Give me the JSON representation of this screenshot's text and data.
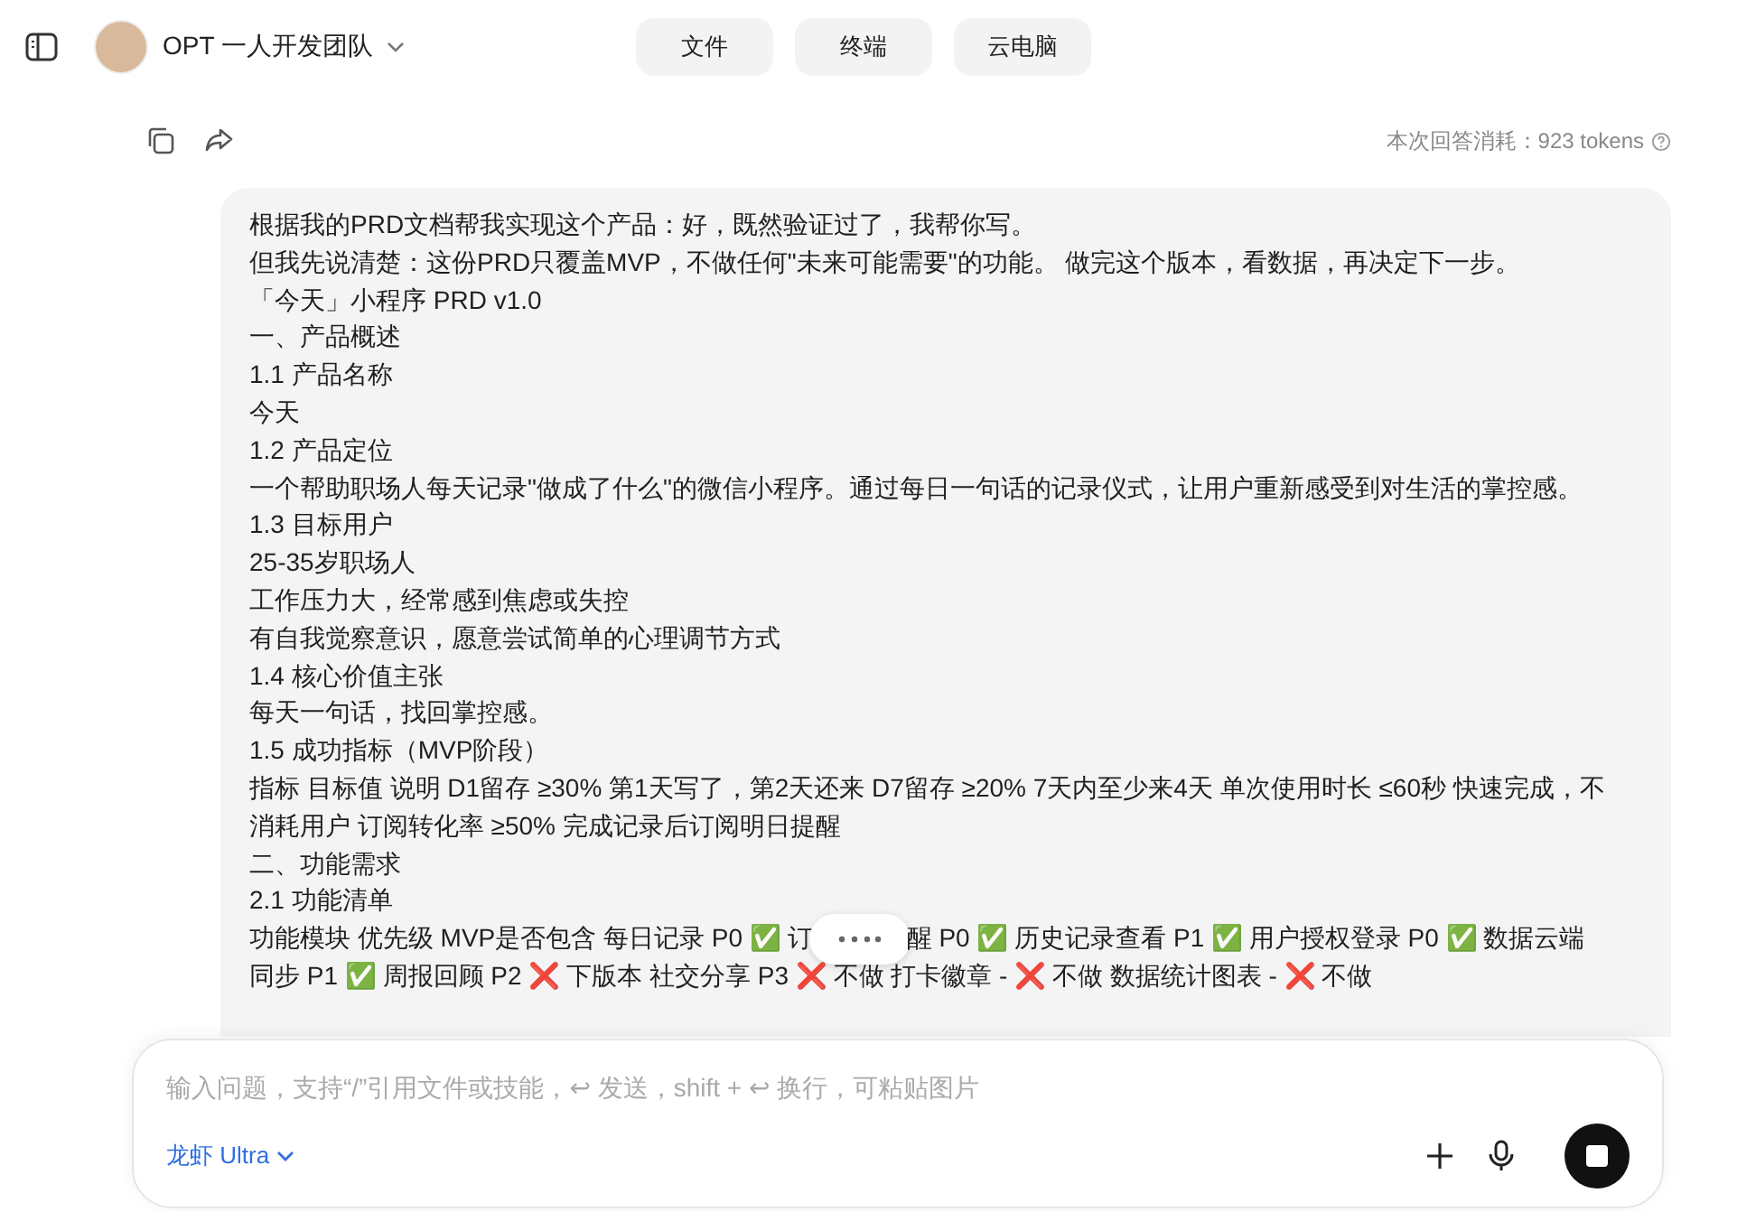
{
  "header": {
    "workspace": {
      "name": "OPT 一人开发团队"
    },
    "buttons": [
      "文件",
      "终端",
      "云电脑"
    ]
  },
  "message": {
    "token_usage": "本次回答消耗：923 tokens",
    "lines": [
      {
        "kind": "text",
        "text": "根据我的PRD文档帮我实现这个产品：好，既然验证过了，我帮你写。"
      },
      {
        "kind": "text",
        "text": "但我先说清楚：这份PRD只覆盖MVP，不做任何\"未来可能需要\"的功能。 做完这个版本，看数据，再决定下一步。"
      },
      {
        "kind": "text",
        "text": "「今天」小程序 PRD v1.0"
      },
      {
        "kind": "text",
        "text": "一、产品概述"
      },
      {
        "kind": "text",
        "text": "1.1 产品名称"
      },
      {
        "kind": "text",
        "text": "今天"
      },
      {
        "kind": "text",
        "text": "1.2 产品定位"
      },
      {
        "kind": "text",
        "text": "一个帮助职场人每天记录\"做成了什么\"的微信小程序。通过每日一句话的记录仪式，让用户重新感受到对生活的掌控感。"
      },
      {
        "kind": "text",
        "text": "1.3 目标用户"
      },
      {
        "kind": "text",
        "text": "25-35岁职场人"
      },
      {
        "kind": "text",
        "text": "工作压力大，经常感到焦虑或失控"
      },
      {
        "kind": "text",
        "text": "有自我觉察意识，愿意尝试简单的心理调节方式"
      },
      {
        "kind": "text",
        "text": "1.4 核心价值主张"
      },
      {
        "kind": "text",
        "text": "每天一句话，找回掌控感。"
      },
      {
        "kind": "text",
        "text": "1.5 成功指标（MVP阶段）"
      },
      {
        "kind": "text",
        "text": "指标 目标值 说明 D1留存 ≥30% 第1天写了，第2天还来 D7留存 ≥20% 7天内至少来4天 单次使用时长 ≤60秒 快速完成，不消耗用户 订阅转化率 ≥50% 完成记录后订阅明日提醒"
      },
      {
        "kind": "text",
        "text": "二、功能需求"
      },
      {
        "kind": "text",
        "text": "2.1 功能清单"
      },
      {
        "kind": "covered",
        "parts": [
          "功能模块 优先级 MVP是否包含 每日记录 P0 ✅ 订",
          "醒 P0 ✅ 历史记录查看 P1 ✅ 用户授权登录 P0 ✅ 数据云端"
        ]
      },
      {
        "kind": "text",
        "text": "同步 P1 ✅ 周报回顾 P2 ❌ 下版本 社交分享 P3 ❌ 不做 打卡徽章 - ❌ 不做 数据统计图表 - ❌ 不做"
      }
    ]
  },
  "composer": {
    "placeholder": "输入问题，支持“/”引用文件或技能，↩ 发送，shift + ↩ 换行，可粘贴图片",
    "model": "龙虾 Ultra"
  }
}
